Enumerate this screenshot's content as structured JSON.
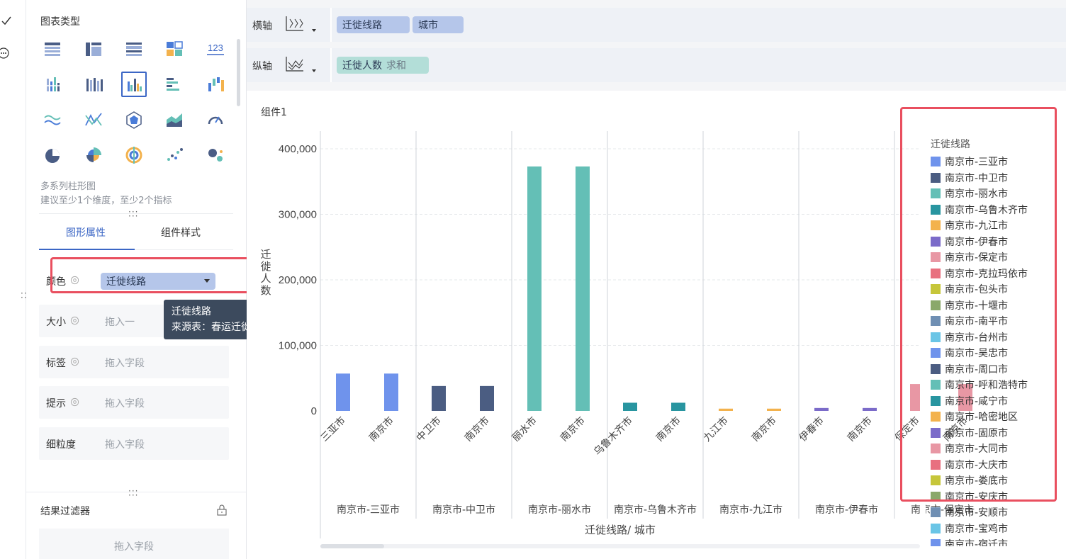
{
  "sidebar": {
    "section_title": "图表类型",
    "chart_types": [
      {
        "icon": "table-icon"
      },
      {
        "icon": "cross-table-icon"
      },
      {
        "icon": "detail-table-icon"
      },
      {
        "icon": "kpi-card-icon"
      },
      {
        "icon": "number-card-icon",
        "text": "123"
      },
      {
        "icon": "grouped-column-icon"
      },
      {
        "icon": "stacked-column-icon"
      },
      {
        "icon": "multi-series-column-icon",
        "selected": true
      },
      {
        "icon": "grouped-bar-icon"
      },
      {
        "icon": "waterfall-icon"
      },
      {
        "icon": "line-icon"
      },
      {
        "icon": "multi-line-icon"
      },
      {
        "icon": "radar-icon"
      },
      {
        "icon": "area-icon"
      },
      {
        "icon": "gauge-icon"
      },
      {
        "icon": "pie-icon"
      },
      {
        "icon": "rose-pie-icon"
      },
      {
        "icon": "multi-pie-icon"
      },
      {
        "icon": "scatter-icon"
      },
      {
        "icon": "bubble-icon"
      }
    ],
    "chart_desc_title": "多系列柱形图",
    "chart_desc_hint": "建议至少1个维度，至少2个指标",
    "tabs": [
      {
        "label": "图形属性",
        "active": true
      },
      {
        "label": "组件样式",
        "active": false
      }
    ],
    "attributes": [
      {
        "label": "颜色",
        "value": "迁徙线路"
      },
      {
        "label": "大小",
        "placeholder": "拖入一"
      },
      {
        "label": "标签",
        "placeholder": "拖入字段"
      },
      {
        "label": "提示",
        "placeholder": "拖入字段"
      },
      {
        "label": "细粒度",
        "placeholder": "拖入字段"
      }
    ],
    "tooltip": {
      "line1": "迁徙线路",
      "line2": "来源表：春运迁徙数据"
    },
    "filter_title": "结果过滤器",
    "filter_placeholder": "拖入字段"
  },
  "axes": {
    "x_label": "横轴",
    "x_fields": [
      "迁徙线路",
      "城市"
    ],
    "y_label": "纵轴",
    "y_field": "迁徙人数",
    "y_agg": "求和"
  },
  "component_title": "组件1",
  "chart_data": {
    "type": "bar",
    "ylabel": "迁徙人数",
    "xlabel": "迁徙线路/ 城市",
    "ylim": [
      0,
      400000
    ],
    "yticks": [
      "400,000",
      "300,000",
      "200,000",
      "100,000",
      "0"
    ],
    "groups": [
      {
        "name": "南京市-三亚市",
        "color": "#6f93ec",
        "cities": [
          "三亚市",
          "南京市"
        ],
        "values": [
          57000,
          57000
        ]
      },
      {
        "name": "南京市-中卫市",
        "color": "#4b5d82",
        "cities": [
          "中卫市",
          "南京市"
        ],
        "values": [
          38000,
          38000
        ]
      },
      {
        "name": "南京市-丽水市",
        "color": "#64bfb6",
        "cities": [
          "丽水市",
          "南京市"
        ],
        "values": [
          373000,
          373000
        ]
      },
      {
        "name": "南京市-乌鲁木齐市",
        "color": "#2895a0",
        "cities": [
          "乌鲁木齐市",
          "南京市"
        ],
        "values": [
          12500,
          12500
        ]
      },
      {
        "name": "南京市-九江市",
        "color": "#f3b24d",
        "cities": [
          "九江市",
          "南京市"
        ],
        "values": [
          3500,
          3500
        ]
      },
      {
        "name": "南京市-伊春市",
        "color": "#7b6bc9",
        "cities": [
          "伊春市",
          "南京市"
        ],
        "values": [
          4500,
          4500
        ]
      },
      {
        "name": "南京市-保定市",
        "color": "#e897a4",
        "cities": [
          "保定市",
          "南京市"
        ],
        "values": [
          41000,
          41000
        ]
      }
    ],
    "legend_title": "迁徙线路",
    "legend": [
      {
        "name": "南京市-三亚市",
        "color": "#6f93ec"
      },
      {
        "name": "南京市-中卫市",
        "color": "#4b5d82"
      },
      {
        "name": "南京市-丽水市",
        "color": "#64bfb6"
      },
      {
        "name": "南京市-乌鲁木齐市",
        "color": "#2895a0"
      },
      {
        "name": "南京市-九江市",
        "color": "#f3b24d"
      },
      {
        "name": "南京市-伊春市",
        "color": "#7b6bc9"
      },
      {
        "name": "南京市-保定市",
        "color": "#e897a4"
      },
      {
        "name": "南京市-克拉玛依市",
        "color": "#e8707f"
      },
      {
        "name": "南京市-包头市",
        "color": "#c6c63a"
      },
      {
        "name": "南京市-十堰市",
        "color": "#8aa86a"
      },
      {
        "name": "南京市-南平市",
        "color": "#6f8fb3"
      },
      {
        "name": "南京市-台州市",
        "color": "#6ac5e6"
      },
      {
        "name": "南京市-吴忠市",
        "color": "#6f93ec"
      },
      {
        "name": "南京市-周口市",
        "color": "#4b5d82"
      },
      {
        "name": "南京市-呼和浩特市",
        "color": "#64bfb6"
      },
      {
        "name": "南京市-咸宁市",
        "color": "#2895a0"
      },
      {
        "name": "南京市-哈密地区",
        "color": "#f3b24d"
      },
      {
        "name": "南京市-固原市",
        "color": "#7b6bc9"
      },
      {
        "name": "南京市-大同市",
        "color": "#e897a4"
      },
      {
        "name": "南京市-大庆市",
        "color": "#e8707f"
      },
      {
        "name": "南京市-娄底市",
        "color": "#c6c63a"
      },
      {
        "name": "南京市-安庆市",
        "color": "#8aa86a"
      },
      {
        "name": "南京市-安顺市",
        "color": "#6f8fb3"
      },
      {
        "name": "南京市-宝鸡市",
        "color": "#6ac5e6"
      },
      {
        "name": "南京市-宿迁市",
        "color": "#6f93ec"
      }
    ]
  }
}
